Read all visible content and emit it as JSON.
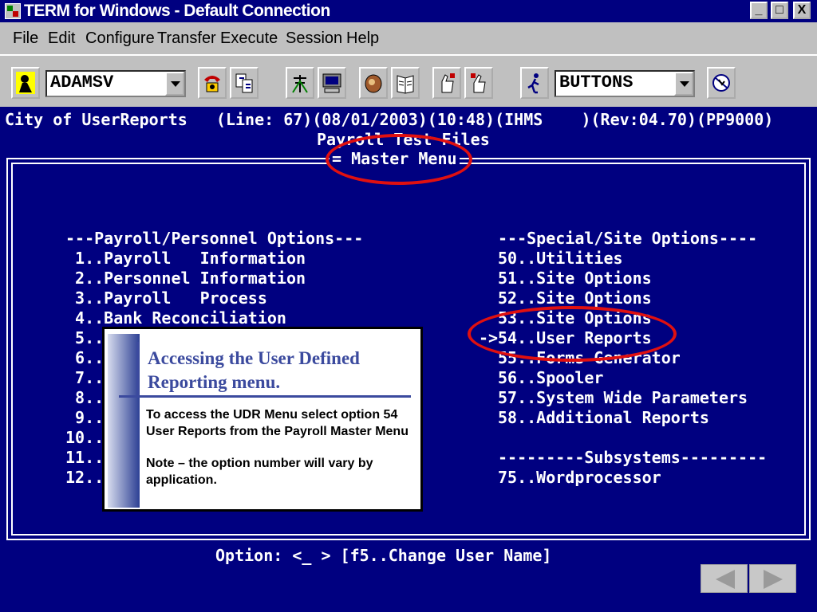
{
  "window": {
    "title": "TERM for Windows - Default Connection",
    "minimize": "_",
    "maximize": "□",
    "close": "X"
  },
  "menubar": [
    {
      "label": "File"
    },
    {
      "label": "Edit"
    },
    {
      "label": "Configure"
    },
    {
      "label": "Transfer"
    },
    {
      "label": "Execute"
    },
    {
      "label": "Session"
    },
    {
      "label": "Help"
    }
  ],
  "toolbar": {
    "user_combo": "ADAMSV",
    "buttons_combo": "BUTTONS"
  },
  "terminal": {
    "status_line": "City of UserReports   (Line: 67)(08/01/2003)(10:48)(IHMS    )(Rev:04.70)(PP9000)",
    "subtitle": "Payroll Test Files",
    "menu_title": "= Master Menu",
    "left_header": "---Payroll/Personnel Options---",
    "left_options": [
      " 1..Payroll   Information",
      " 2..Personnel Information",
      " 3..Payroll   Process",
      " 4..Bank Reconciliation",
      " 5..",
      " 6..",
      " 7..",
      " 8..",
      " 9..",
      "10..",
      "11..",
      "12.."
    ],
    "right_header": "---Special/Site Options----",
    "right_options": [
      "50..Utilities",
      "51..Site Options",
      "52..Site Options",
      "53..Site Options",
      "54..User Reports",
      "55..Forms Generator",
      "56..Spooler",
      "57..System Wide Parameters",
      "58..Additional Reports"
    ],
    "selection_marker": "->",
    "subsystems_header": "---------Subsystems---------",
    "subsystems": [
      "75..Wordprocessor"
    ],
    "prompt": "Option: <_ > [f5..Change User Name]"
  },
  "callout": {
    "title": "Accessing the User Defined Reporting menu.",
    "body": "To access the UDR Menu select option 54 User Reports  from the Payroll Master Menu",
    "note": "Note – the option number will vary by application."
  },
  "colors": {
    "terminal_bg": "#000080",
    "terminal_fg": "#ffffff",
    "highlight": "#e01010",
    "callout_accent": "#3b4a9e"
  },
  "icons": [
    "app-icon",
    "user-icon",
    "phone-icon",
    "transfer-icon",
    "antenna-icon",
    "computer-icon",
    "glove-icon",
    "book-icon",
    "hand-icon",
    "hand-point-icon",
    "runner-icon",
    "stop-icon",
    "arrow-left-icon",
    "arrow-right-icon"
  ]
}
